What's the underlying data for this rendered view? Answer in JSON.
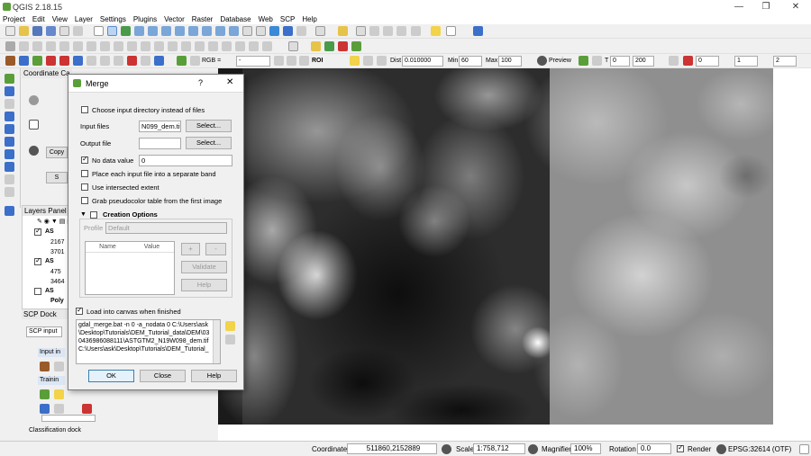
{
  "window": {
    "title": "QGIS 2.18.15",
    "minimize": "—",
    "maximize": "❐",
    "close": "✕"
  },
  "menu": [
    "Project",
    "Edit",
    "View",
    "Layer",
    "Settings",
    "Plugins",
    "Vector",
    "Raster",
    "Database",
    "Web",
    "SCP",
    "Help"
  ],
  "toolbar3": {
    "rgb": "RGB =",
    "band_sel": "-",
    "roi": "ROI",
    "dist_label": "Dist",
    "dist_value": "0.010000",
    "min_label": "Min",
    "min_value": "60",
    "max_label": "Max",
    "max_value": "100",
    "preview": "Preview",
    "t_label": "T",
    "t_value": "0",
    "s_value": "200",
    "f1": "0",
    "f2": "1",
    "f3": "2"
  },
  "coord_panel": {
    "title": "Coordinate Ca",
    "copy": "Copy",
    "s_button": "S"
  },
  "layers_panel": {
    "title": "Layers Panel",
    "layers": [
      {
        "name": "AS",
        "sub": [
          "2167",
          "3701"
        ]
      },
      {
        "name": "AS",
        "sub": [
          "475",
          "3464"
        ]
      },
      {
        "name": "AS",
        "sub": []
      },
      {
        "name": "Poly",
        "sub": []
      }
    ]
  },
  "scp_dock": {
    "title": "SCP Dock",
    "tab": "SCP input",
    "input": "Input in",
    "training": "Trainin",
    "classification": "Classification dock"
  },
  "dialog": {
    "title": "Merge",
    "help_q": "?",
    "close": "✕",
    "choose_dir": "Choose input directory instead of files",
    "input_files_label": "Input files",
    "input_files_value": "N099_dem.tif",
    "select1": "Select...",
    "output_file_label": "Output file",
    "output_file_value": "",
    "select2": "Select...",
    "no_data_label": "No data value",
    "no_data_value": "0",
    "separate_band": "Place each input file into a separate band",
    "intersected": "Use intersected extent",
    "pseudocolor": "Grab pseudocolor table from the first image",
    "creation_options": "Creation Options",
    "profile_label": "Profile",
    "profile_value": "Default",
    "col_name": "Name",
    "col_value": "Value",
    "plus": "+",
    "minus": "-",
    "validate": "Validate",
    "help_btn_inner": "Help",
    "load_canvas": "Load into canvas when finished",
    "command": "gdal_merge.bat -n 0 -a_nodata 0 C:\\Users\\ask\\Desktop\\Tutorials\\DEM_Tutorial_data\\DEM\\030436986088111\\ASTGTM2_N19W098_dem.tif C:\\Users\\ask\\Desktop\\Tutorials\\DEM_Tutorial_",
    "ok": "OK",
    "close_btn": "Close",
    "help": "Help"
  },
  "status": {
    "coordinate_label": "Coordinate",
    "coordinate_value": "511860,2152889",
    "scale_label": "Scale",
    "scale_value": "1:758,712",
    "magnifier_label": "Magnifier",
    "magnifier_value": "100%",
    "rotation_label": "Rotation",
    "rotation_value": "0.0",
    "render_label": "Render",
    "crs": "EPSG:32614 (OTF)"
  },
  "colors": {
    "qgis_green": "#5a9e3a",
    "selection_blue": "#3b6fc9"
  }
}
